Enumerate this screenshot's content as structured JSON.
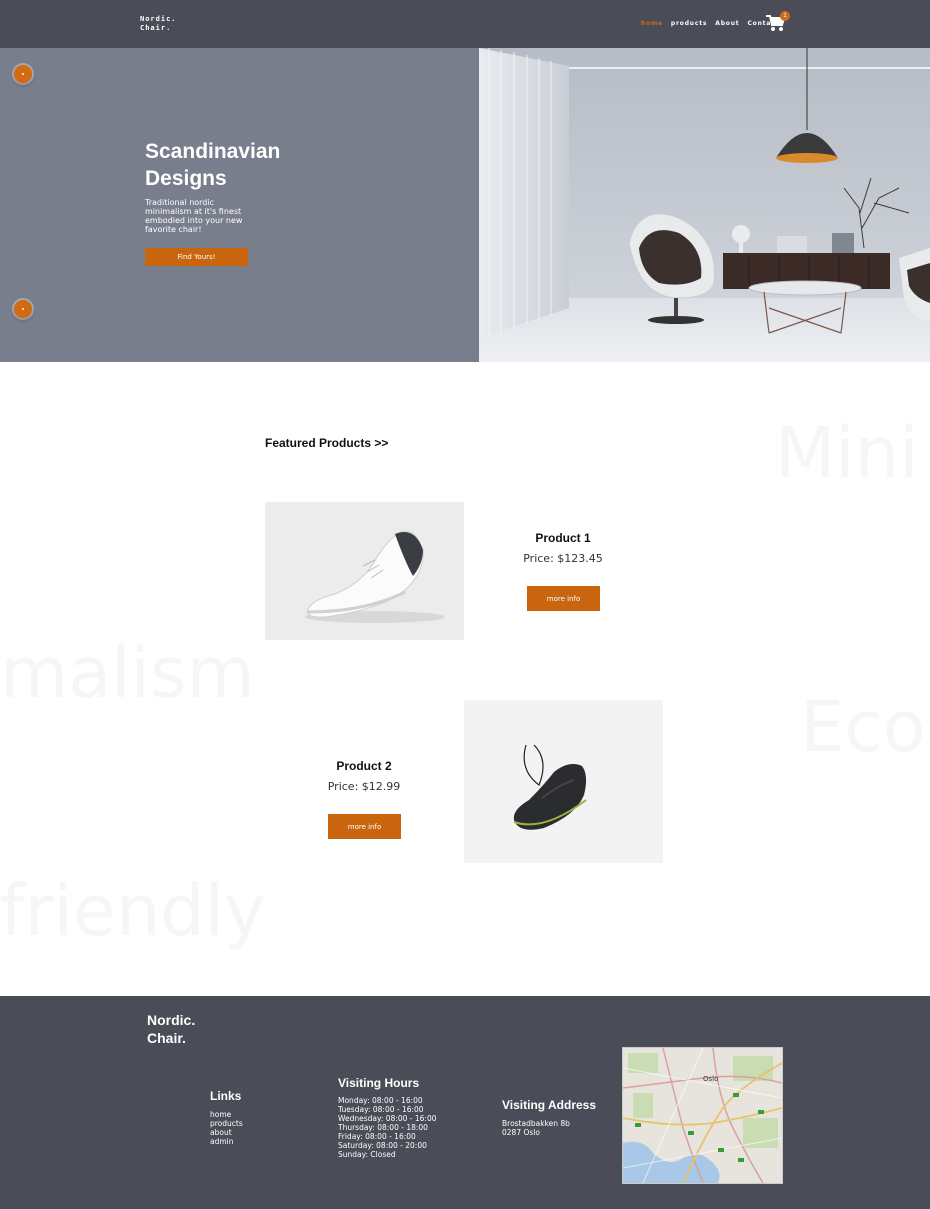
{
  "nav": {
    "logo_line1": "Nordic.",
    "logo_line2": "Chair.",
    "links": [
      "home",
      "products",
      "About",
      "Contact"
    ],
    "active_index": 0,
    "cart_count": "1",
    "cart_icon": "cart-icon"
  },
  "hero": {
    "title_line1": "Scandinavian",
    "title_line2": "Designs",
    "subtitle": "Traditional nordic minimalism at it's finest embodied into your new favorite chair!",
    "button": "Find Yours!"
  },
  "background_words": [
    "Mini",
    "malism",
    "Eco",
    "friendly"
  ],
  "featured": {
    "heading": "Featured Products >>"
  },
  "products": [
    {
      "title": "Product 1",
      "price": "Price: $123.45",
      "button": "more info"
    },
    {
      "title": "Product 2",
      "price": "Price: $12.99",
      "button": "more info"
    }
  ],
  "footer": {
    "logo_line1": "Nordic.",
    "logo_line2": "Chair.",
    "links_heading": "Links",
    "links": [
      "home",
      "products",
      "about",
      "admin"
    ],
    "hours_heading": "Visiting Hours",
    "hours": [
      "Monday: 08:00 - 16:00",
      "Tuesday: 08:00 - 16:00",
      "Wednesday: 08:00 - 16:00",
      "Thursday: 08:00 - 18:00",
      "Friday: 08:00 - 16:00",
      "Saturday: 08:00 - 20:00",
      "Sunday: Closed"
    ],
    "address_heading": "Visiting Address",
    "address_line1": "Brostadbakken 8b",
    "address_line2": "0287 Oslo",
    "map_label": "Oslo"
  },
  "colors": {
    "accent": "#c9650f",
    "nav_bg": "#4a4d57",
    "hero_bg": "#797e8c"
  }
}
